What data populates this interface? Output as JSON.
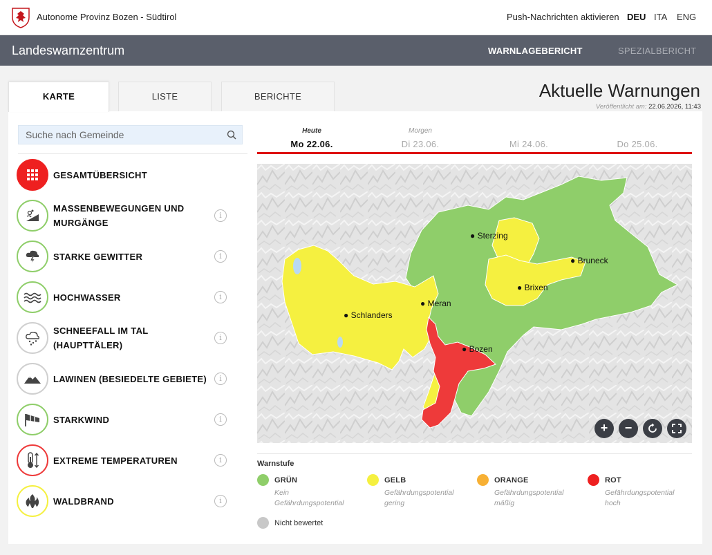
{
  "header": {
    "org_name": "Autonome Provinz Bozen - Südtirol",
    "push_label": "Push-Nachrichten aktivieren",
    "languages": [
      "DEU",
      "ITA",
      "ENG"
    ],
    "active_language": "DEU"
  },
  "navbar": {
    "brand": "Landeswarnzentrum",
    "items": [
      "WARNLAGEBERICHT",
      "SPEZIALBERICHT"
    ],
    "active_item": "WARNLAGEBERICHT"
  },
  "tabs": [
    {
      "label": "KARTE",
      "active": true
    },
    {
      "label": "LISTE",
      "active": false
    },
    {
      "label": "BERICHTE",
      "active": false
    }
  ],
  "page": {
    "title": "Aktuelle Warnungen",
    "published_label": "Veröffentlicht am:",
    "published_value": "22.06.2026, 11:43"
  },
  "search": {
    "placeholder": "Suche nach Gemeinde",
    "value": ""
  },
  "hazards": [
    {
      "label": "GESAMTÜBERSICHT",
      "icon": "grid-icon",
      "level": "rot",
      "info": false
    },
    {
      "label": "MASSENBEWEGUNGEN UND MURGÄNGE",
      "line1": "MASSENBEWEGUNGEN UND",
      "line2": "MURGÄNGE",
      "icon": "landslide-icon",
      "level": "gruen",
      "info": true
    },
    {
      "label": "STARKE GEWITTER",
      "icon": "thunderstorm-icon",
      "level": "gruen",
      "info": true
    },
    {
      "label": "HOCHWASSER",
      "icon": "flood-icon",
      "level": "gruen",
      "info": true
    },
    {
      "label": "SCHNEEFALL IM TAL (HAUPTTÄLER)",
      "line1": "SCHNEEFALL IM TAL",
      "line2": "(HAUPTTÄLER)",
      "icon": "snowfall-icon",
      "level": "nicht_bewertet",
      "info": true
    },
    {
      "label": "LAWINEN (BESIEDELTE GEBIETE)",
      "icon": "avalanche-icon",
      "level": "nicht_bewertet",
      "info": true
    },
    {
      "label": "STARKWIND",
      "icon": "windsock-icon",
      "level": "gruen",
      "info": true
    },
    {
      "label": "EXTREME TEMPERATUREN",
      "icon": "thermometer-icon",
      "level": "rot",
      "info": true
    },
    {
      "label": "WALDBRAND",
      "icon": "wildfire-icon",
      "level": "gelb",
      "info": true
    }
  ],
  "info_glyph": "i",
  "days": [
    {
      "sub": "Heute",
      "date": "Mo 22.06.",
      "active": true
    },
    {
      "sub": "Morgen",
      "date": "Di 23.06.",
      "active": false
    },
    {
      "sub": "",
      "date": "Mi 24.06.",
      "active": false
    },
    {
      "sub": "",
      "date": "Do 25.06.",
      "active": false
    }
  ],
  "map": {
    "cities": [
      "Sterzing",
      "Bruneck",
      "Brixen",
      "Meran",
      "Schlanders",
      "Bozen"
    ],
    "controls": [
      "+",
      "−",
      "reset-icon",
      "fullscreen-icon"
    ]
  },
  "legend": {
    "title": "Warnstufe",
    "items": [
      {
        "name": "GRÜN",
        "desc1": "Kein",
        "desc2": "Gefährdungspotential",
        "color": "#8fce6a"
      },
      {
        "name": "GELB",
        "desc1": "Gefährdungspotential",
        "desc2": "gering",
        "color": "#f5f040"
      },
      {
        "name": "ORANGE",
        "desc1": "Gefährdungspotential",
        "desc2": "mäßig",
        "color": "#f7b034"
      },
      {
        "name": "ROT",
        "desc1": "Gefährdungspotential",
        "desc2": "hoch",
        "color": "#ee3a3a"
      }
    ],
    "not_rated": "Nicht bewertet",
    "not_rated_color": "#c8c8c8"
  },
  "colors": {
    "navbar": "#5a5f6b",
    "accent_red": "#dd1111",
    "green": "#8fce6a",
    "yellow": "#f5f040",
    "red": "#ee3a3a"
  }
}
